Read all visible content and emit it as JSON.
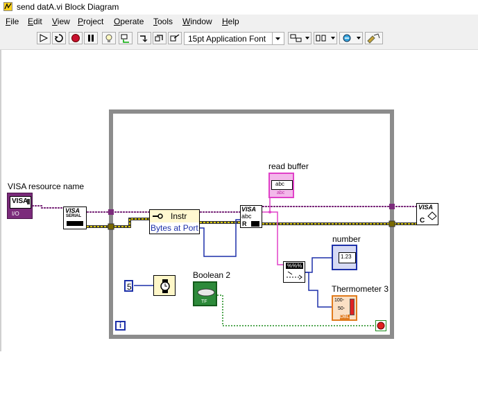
{
  "window": {
    "title": "send datA.vi Block Diagram"
  },
  "menu": [
    "File",
    "Edit",
    "View",
    "Project",
    "Operate",
    "Tools",
    "Window",
    "Help"
  ],
  "toolbar": {
    "font": "15pt Application Font",
    "buttons": [
      "run-continuous-icon",
      "abort-icon",
      "pause-icon",
      "highlight-execution-icon",
      "retain-wire-values-icon",
      "step-into-icon",
      "step-over-icon",
      "step-out-icon",
      "align-objects-icon",
      "distribute-objects-icon",
      "reorder-icon",
      "clean-up-diagram-icon"
    ]
  },
  "diagram": {
    "labels": {
      "visa_resource": "VISA resource name",
      "read_buffer": "read buffer",
      "number": "number",
      "boolean": "Boolean 2",
      "thermometer": "Thermometer 3"
    },
    "nodes": {
      "visa_resource_text": "VISA",
      "visa_resource_type": "I/O",
      "serial_top": "VISA",
      "serial_bottom": "SERIAL",
      "property_class": "Instr",
      "property_item": "Bytes at Port",
      "read_top": "VISA",
      "read_mid": "abc",
      "read_r": "R",
      "read_buffer_indicator": "abc",
      "read_buffer_type": "abc",
      "number_value": "1.23",
      "wait_constant": "5",
      "bool_type": "TF",
      "thermo_100": "100-",
      "thermo_50": "50-",
      "thermo_type": "DBL",
      "close_top": "VISA",
      "close_bottom": "C",
      "scan_format": "%%%",
      "iteration": "i"
    }
  }
}
